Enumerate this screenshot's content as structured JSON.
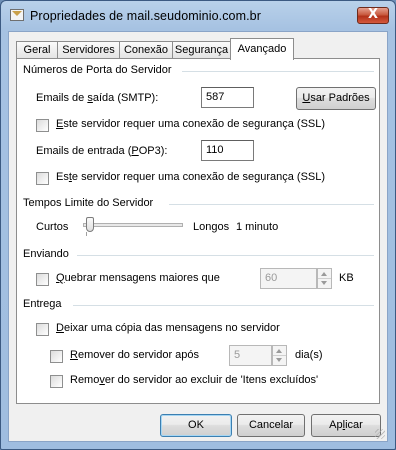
{
  "window": {
    "title": "Propriedades de mail.seudominio.com.br",
    "close_symbol": "X"
  },
  "tabs": [
    {
      "label": "Geral",
      "active": false
    },
    {
      "label": "Servidores",
      "active": false
    },
    {
      "label": "Conexão",
      "active": false
    },
    {
      "label": "Segurança",
      "active": false
    },
    {
      "label": "Avançado",
      "active": true
    }
  ],
  "ports": {
    "heading": "Números de Porta do Servidor",
    "outgoing_label_pre": "Emails de ",
    "outgoing_label_key": "s",
    "outgoing_label_post": "aída (SMTP):",
    "outgoing_value": "587",
    "defaults_button_key": "U",
    "defaults_button_rest": "sar Padrões",
    "ssl_outgoing_key": "E",
    "ssl_outgoing_rest": "ste servidor requer uma conexão de segurança (SSL)",
    "ssl_outgoing_checked": false,
    "incoming_label_pre": "Emails de entrada (",
    "incoming_label_key": "P",
    "incoming_label_post": "OP3):",
    "incoming_value": "110",
    "ssl_incoming_pre": "Es",
    "ssl_incoming_key": "t",
    "ssl_incoming_rest": "e servidor requer uma conexão de segurança (SSL)",
    "ssl_incoming_checked": false
  },
  "timeouts": {
    "heading": "Tempos Limite do Servidor",
    "short_label": "Curtos",
    "long_label": "Longos",
    "value_label": "1 minuto",
    "slider_fraction": 0.03
  },
  "sending": {
    "heading": "Enviando",
    "split_key": "Q",
    "split_rest": "uebrar mensagens maiores que",
    "split_checked": false,
    "split_value": "60",
    "split_unit": "KB"
  },
  "delivery": {
    "heading": "Entrega",
    "leave_copy_key": "D",
    "leave_copy_rest": "eixar uma cópia das mensagens no servidor",
    "leave_copy_checked": false,
    "remove_after_key": "R",
    "remove_after_rest": "emover do servidor após",
    "remove_after_checked": false,
    "remove_after_value": "5",
    "remove_after_unit": "dia(s)",
    "remove_deleted_pre": "Remo",
    "remove_deleted_key": "v",
    "remove_deleted_rest": "er do servidor ao excluir de 'Itens excluídos'",
    "remove_deleted_checked": false
  },
  "footer": {
    "ok_label": "OK",
    "cancel_label": "Cancelar",
    "apply_pre": "Ap",
    "apply_key": "l",
    "apply_rest": "icar"
  }
}
